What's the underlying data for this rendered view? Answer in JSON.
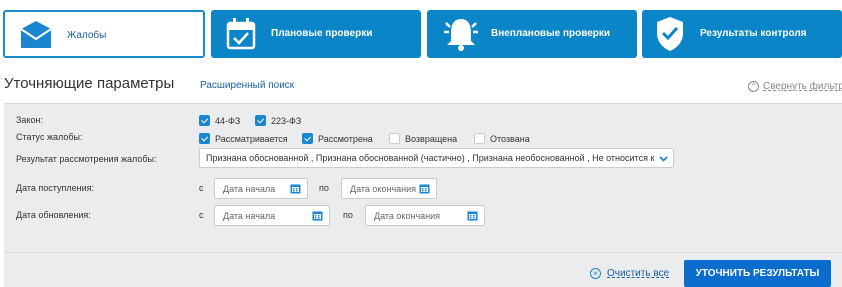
{
  "tabs": [
    {
      "label": "Жалобы",
      "icon": "envelope-icon",
      "active": true
    },
    {
      "label": "Плановые проверки",
      "icon": "calendar-check-icon",
      "active": false
    },
    {
      "label": "Внеплановые проверки",
      "icon": "alarm-bell-icon",
      "active": false
    },
    {
      "label": "Результаты контроля",
      "icon": "shield-check-icon",
      "active": false
    }
  ],
  "header": {
    "title": "Уточняющие параметры",
    "advanced_search": "Расширенный поиск",
    "collapse": "Свернуть фильтр"
  },
  "filters": {
    "law": {
      "label": "Закон:",
      "options": [
        {
          "label": "44-ФЗ",
          "checked": true
        },
        {
          "label": "223-ФЗ",
          "checked": true
        }
      ]
    },
    "status": {
      "label": "Статус жалобы:",
      "options": [
        {
          "label": "Рассматривается",
          "checked": true
        },
        {
          "label": "Рассмотрена",
          "checked": true
        },
        {
          "label": "Возвращена",
          "checked": false
        },
        {
          "label": "Отозвана",
          "checked": false
        }
      ]
    },
    "result": {
      "label": "Результат рассмотрения жалобы:",
      "value": "Признана обоснованной , Признана обоснованной (частично) , Признана необоснованной , Не относится к компетенции"
    },
    "received": {
      "label": "Дата поступления:",
      "from_label": "с",
      "to_label": "по",
      "from_placeholder": "Дата начала",
      "to_placeholder": "Дата окончания"
    },
    "updated": {
      "label": "Дата обновления:",
      "from_label": "с",
      "to_label": "по",
      "from_placeholder": "Дата начала",
      "to_placeholder": "Дата окончания"
    }
  },
  "footer": {
    "clear": "Очистить все",
    "apply": "УТОЧНИТЬ РЕЗУЛЬТАТЫ"
  },
  "colors": {
    "tab_blue": "#0a86c8",
    "accent": "#1a86d0",
    "panel_bg": "#eaecee",
    "button_blue": "#0a6ccc"
  }
}
